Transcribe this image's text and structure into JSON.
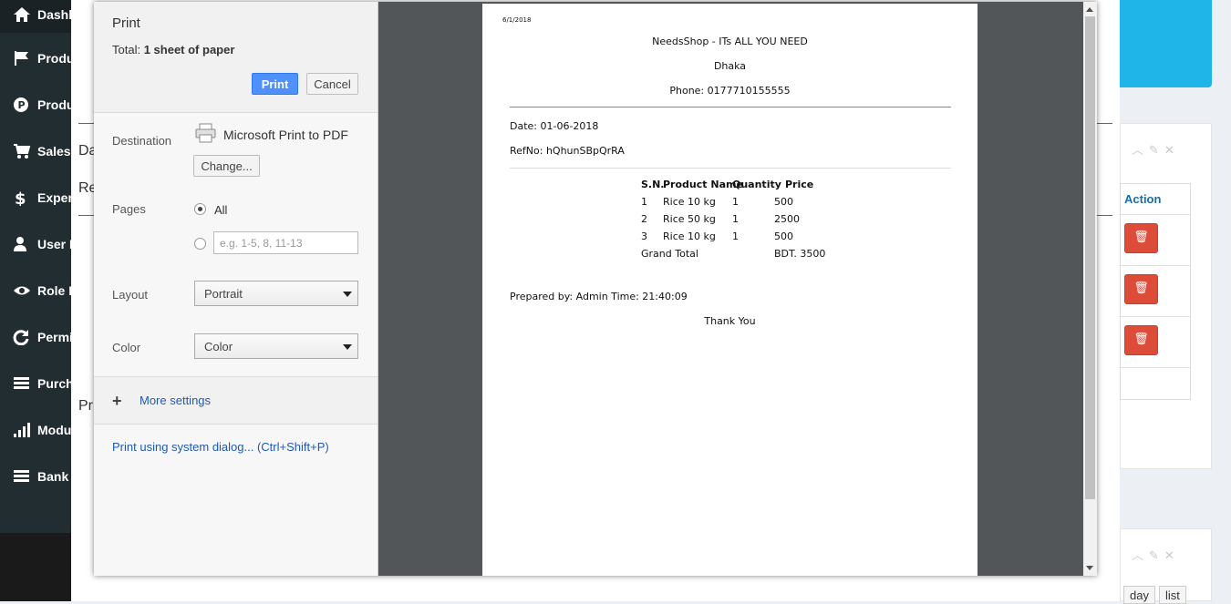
{
  "sidebar": {
    "items": [
      {
        "label": "Dashb",
        "icon": "home-icon"
      },
      {
        "label": "Produ",
        "icon": "flag-icon"
      },
      {
        "label": "Produ",
        "icon": "p-circle-icon"
      },
      {
        "label": "Sales",
        "icon": "cart-icon"
      },
      {
        "label": "Expen",
        "icon": "dollar-icon"
      },
      {
        "label": "User M",
        "icon": "user-icon"
      },
      {
        "label": "Role M",
        "icon": "eye-icon"
      },
      {
        "label": "Permis",
        "icon": "refresh-icon"
      },
      {
        "label": "Purcha",
        "icon": "list-icon"
      },
      {
        "label": "Modul",
        "icon": "signal-icon"
      },
      {
        "label": "Bank T",
        "icon": "list-icon"
      }
    ]
  },
  "background": {
    "text_da": "Da",
    "text_re": "Re",
    "text_pr": "Pr",
    "action_header": "Action",
    "calendar_buttons": [
      "day",
      "list"
    ]
  },
  "print_dialog": {
    "title": "Print",
    "total_label": "Total:",
    "total_value": "1 sheet of paper",
    "print_button": "Print",
    "cancel_button": "Cancel",
    "destination_label": "Destination",
    "destination_name": "Microsoft Print to PDF",
    "change_button": "Change...",
    "pages_label": "Pages",
    "pages_all": "All",
    "pages_placeholder": "e.g. 1-5, 8, 11-13",
    "layout_label": "Layout",
    "layout_value": "Portrait",
    "color_label": "Color",
    "color_value": "Color",
    "more_settings": "More settings",
    "system_dialog": "Print using system dialog... (Ctrl+Shift+P)"
  },
  "receipt": {
    "print_date": "6/1/2018",
    "shop_name": "NeedsShop - ITs ALL YOU NEED",
    "city": "Dhaka",
    "phone": "Phone: 0177710155555",
    "date": "Date: 01-06-2018",
    "ref": "RefNo: hQhunSBpQrRA",
    "headers": {
      "sn": "S.N.",
      "product": "Product Name",
      "qty": "Quantity",
      "price": "Price"
    },
    "rows": [
      {
        "sn": "1",
        "product": "Rice 10 kg",
        "qty": "1",
        "price": "500"
      },
      {
        "sn": "2",
        "product": "Rice 50 kg",
        "qty": "1",
        "price": "2500"
      },
      {
        "sn": "3",
        "product": "Rice 10 kg",
        "qty": "1",
        "price": "500"
      }
    ],
    "grand_total_label": "Grand Total",
    "grand_total_value": "BDT. 3500",
    "prepared_by": "Prepared by: Admin Time: 21:40:09",
    "thanks": "Thank You"
  }
}
